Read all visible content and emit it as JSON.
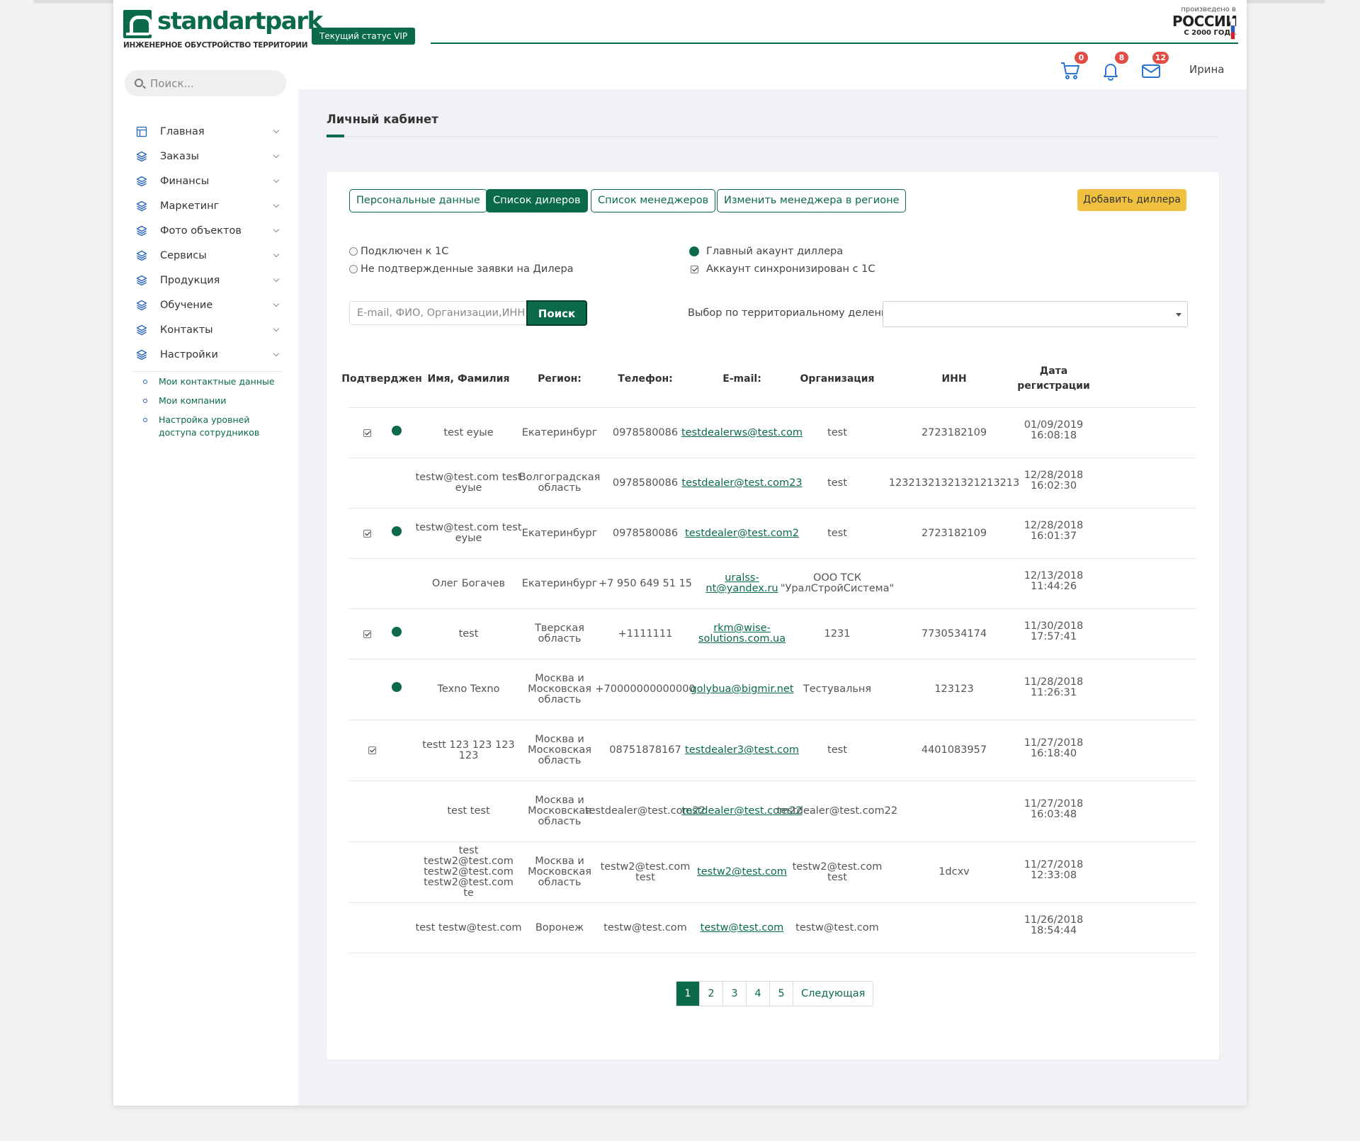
{
  "brand": {
    "name": "standartpark",
    "tagline": "ИНЖЕНЕРНОЕ ОБУСТРОЙСТВО ТЕРРИТОРИИ",
    "made_in_line1": "произведено в",
    "made_in_line2": "РОССИИ",
    "made_in_line3": "С 2000 ГОДА",
    "accent_color": "#0b6b48"
  },
  "sidebar": {
    "search_placeholder": "Поиск...",
    "items": [
      {
        "label": "Главная",
        "icon": "layout-icon"
      },
      {
        "label": "Заказы",
        "icon": "layers-icon"
      },
      {
        "label": "Финансы",
        "icon": "layers-icon"
      },
      {
        "label": "Маркетинг",
        "icon": "layers-icon"
      },
      {
        "label": "Фото объектов",
        "icon": "layers-icon"
      },
      {
        "label": "Сервисы",
        "icon": "layers-icon"
      },
      {
        "label": "Продукция",
        "icon": "layers-icon"
      },
      {
        "label": "Обучение",
        "icon": "layers-icon"
      },
      {
        "label": "Контакты",
        "icon": "layers-icon"
      },
      {
        "label": "Настройки",
        "icon": "layers-icon"
      }
    ],
    "subitems": [
      "Мои контактные данные",
      "Мои компании",
      "Настройка уровней доступа сотрудников"
    ]
  },
  "header": {
    "status": "Текущий статус VIP",
    "cart_count": "0",
    "notifications_count": "8",
    "messages_count": "12",
    "user_name": "Ирина"
  },
  "page": {
    "title": "Личный кабинет",
    "tabs": [
      "Персональные данные",
      "Список дилеров",
      "Список менеджеров",
      "Изменить менеджера в регионе"
    ],
    "add_dealer": "Добавить диллера",
    "legend": {
      "connected_1c": "Подключен к 1С",
      "unconfirmed": "Не подтвержденные заявки на Дилера",
      "main_account": "Главный акаунт диллера",
      "synced_1c": "Аккаунт синхронизирован с 1С"
    },
    "filter": {
      "placeholder": "E-mail, ФИО, Организации,ИНН",
      "search_button": "Поиск",
      "region_label": "Выбор по территориальному делению:",
      "region_value": ""
    }
  },
  "table": {
    "headers": [
      "Подтверджен",
      "Имя, Фамилия",
      "Регион:",
      "Телефон:",
      "E-mail:",
      "Организация",
      "ИНН",
      "Дата регистрации"
    ],
    "rows": [
      {
        "synced": true,
        "main": true,
        "name": "test еуые",
        "region": "Екатеринбург",
        "phone": "0978580086",
        "email": "testdealerws@test.com",
        "org": "test",
        "inn": "2723182109",
        "date": "01/09/2019",
        "time": "16:08:18"
      },
      {
        "synced": false,
        "main": false,
        "name": "testw@test.com test еуые",
        "region": "Волгоградская область",
        "phone": "0978580086",
        "email": "testdealer@test.com23",
        "org": "test",
        "inn": "12321321321321213213",
        "date": "12/28/2018",
        "time": "16:02:30"
      },
      {
        "synced": true,
        "main": true,
        "name": "testw@test.com test еуые",
        "region": "Екатеринбург",
        "phone": "0978580086",
        "email": "testdealer@test.com2",
        "org": "test",
        "inn": "2723182109",
        "date": "12/28/2018",
        "time": "16:01:37"
      },
      {
        "synced": false,
        "main": false,
        "name": "Олег Богачев",
        "region": "Екатеринбург",
        "phone": "+7 950 649 51 15",
        "email": "uralss-nt@yandex.ru",
        "org": "ООО ТСК \"УралСтройСистема\"",
        "inn": "",
        "date": "12/13/2018",
        "time": "11:44:26"
      },
      {
        "synced": true,
        "main": true,
        "name": "test",
        "region": "Тверская область",
        "phone": "+1111111",
        "email": "rkm@wise-solutions.com.ua",
        "org": "1231",
        "inn": "7730534174",
        "date": "11/30/2018",
        "time": "17:57:41"
      },
      {
        "synced": false,
        "main": true,
        "name": "Texno Texno",
        "region": "Москва и Московская область",
        "phone": "+70000000000000",
        "email": "golybua@bigmir.net",
        "org": "Тестувальня",
        "inn": "123123",
        "date": "11/28/2018",
        "time": "11:26:31"
      },
      {
        "synced": true,
        "main": false,
        "name": "testt 123 123 123 123",
        "region": "Москва и Московская область",
        "phone": "08751878167",
        "email": "testdealer3@test.com",
        "org": "test",
        "inn": "4401083957",
        "date": "11/27/2018",
        "time": "16:18:40"
      },
      {
        "synced": false,
        "main": false,
        "name": "test test",
        "region": "Москва и Московская область",
        "phone": "testdealer@test.com22",
        "email": "testdealer@test.com22",
        "org": "testdealer@test.com22",
        "inn": "",
        "date": "11/27/2018",
        "time": "16:03:48"
      },
      {
        "synced": false,
        "main": false,
        "name": "test testw2@test.com testw2@test.com testw2@test.com te",
        "region": "Москва и Московская область",
        "phone": "testw2@test.com test",
        "email": "testw2@test.com",
        "org": "testw2@test.com test",
        "inn": "1dcxv",
        "date": "11/27/2018",
        "time": "12:33:08"
      },
      {
        "synced": false,
        "main": false,
        "name": "test testw@test.com",
        "region": "Воронеж",
        "phone": "testw@test.com",
        "email": "testw@test.com",
        "org": "testw@test.com",
        "inn": "",
        "date": "11/26/2018",
        "time": "18:54:44"
      }
    ]
  },
  "pagination": {
    "pages": [
      "1",
      "2",
      "3",
      "4",
      "5"
    ],
    "current": "1",
    "next": "Следующая"
  }
}
